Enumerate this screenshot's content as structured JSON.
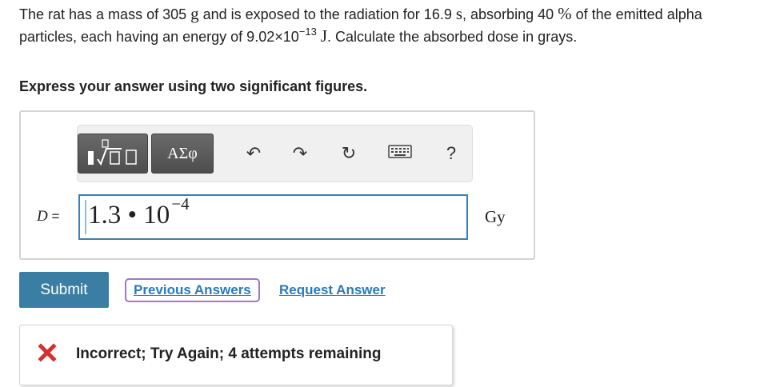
{
  "problem": {
    "part1": "The rat has a mass of 305 ",
    "unit_mass": "g",
    "part2": " and is exposed to the radiation for 16.9 ",
    "unit_time": "s",
    "part3": ", absorbing 40 ",
    "unit_percent": "%",
    "part4": " of the emitted alpha particles, each having an energy of 9.02×10",
    "exponent": "−13",
    "part5": " ",
    "unit_energy": "J",
    "part6": ". Calculate the absorbed dose in grays."
  },
  "instruction": "Express your answer using two significant figures.",
  "toolbar": {
    "greek_label": "ΑΣφ",
    "undo_glyph": "↶",
    "redo_glyph": "↷",
    "reset_glyph": "↻",
    "help_label": "?"
  },
  "answer": {
    "variable": "D",
    "equals": " = ",
    "value_mantissa": "1.3 • 10",
    "value_exponent": "−4",
    "unit": "Gy"
  },
  "buttons": {
    "submit": "Submit",
    "previous_answers": "Previous Answers",
    "request_answer": "Request Answer"
  },
  "feedback": {
    "message": "Incorrect; Try Again; 4 attempts remaining",
    "status_color": "#d32f2f"
  },
  "colors": {
    "accent": "#3a7fa3",
    "link": "#2b7ab8",
    "input_border": "#3c7fb1",
    "visited_outline": "#9e77c7"
  }
}
